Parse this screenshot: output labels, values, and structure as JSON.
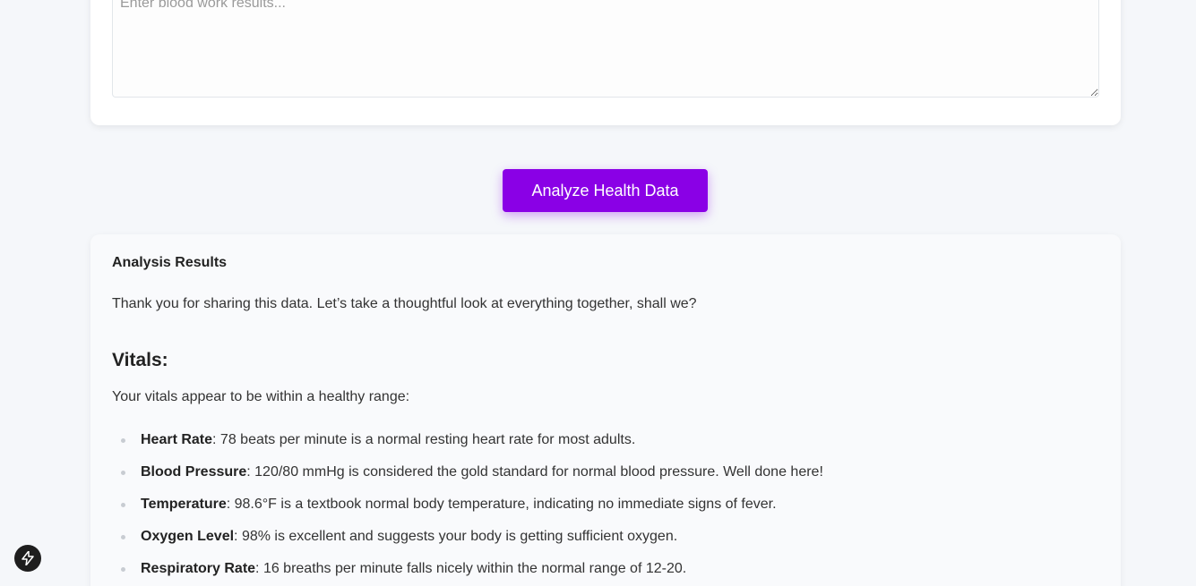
{
  "bloodwork": {
    "placeholder": "Enter blood work results..."
  },
  "actions": {
    "analyze_label": "Analyze Health Data"
  },
  "results": {
    "title": "Analysis Results",
    "intro": "Thank you for sharing this data. Let’s take a thoughtful look at everything together, shall we?",
    "vitals_heading": "Vitals:",
    "vitals_intro": "Your vitals appear to be within a healthy range:",
    "vitals": [
      {
        "name": "Heart Rate",
        "text": ": 78 beats per minute is a normal resting heart rate for most adults."
      },
      {
        "name": "Blood Pressure",
        "text": ": 120/80 mmHg is considered the gold standard for normal blood pressure. Well done here!"
      },
      {
        "name": "Temperature",
        "text": ": 98.6°F is a textbook normal body temperature, indicating no immediate signs of fever."
      },
      {
        "name": "Oxygen Level",
        "text": ": 98% is excellent and suggests your body is getting sufficient oxygen."
      },
      {
        "name": "Respiratory Rate",
        "text": ": 16 breaths per minute falls nicely within the normal range of 12-20."
      }
    ]
  },
  "widget": {
    "icon": "lightning-bolt-icon"
  }
}
